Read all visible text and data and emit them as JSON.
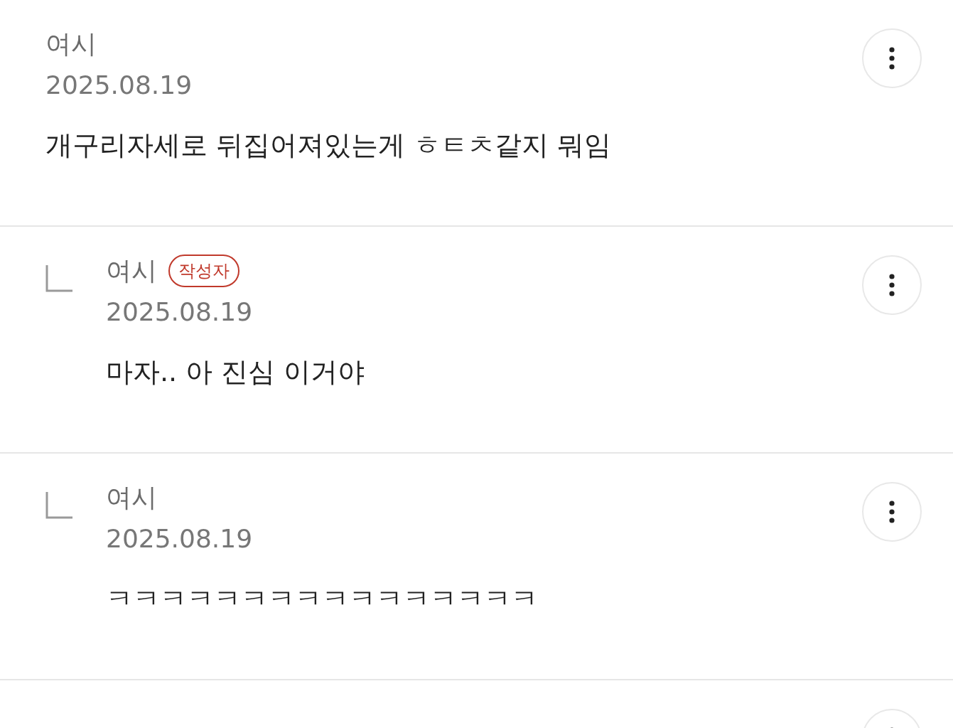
{
  "comments": [
    {
      "kind": "comment",
      "author": "여시",
      "date": "2025.08.19",
      "text": "개구리자세로 뒤집어져있는게 ㅎㅌㅊ같지 뭐임"
    },
    {
      "kind": "reply",
      "author": "여시",
      "writer_badge": "작성자",
      "date": "2025.08.19",
      "text": "마자.. 아 진심 이거야"
    },
    {
      "kind": "reply",
      "author": "여시",
      "date": "2025.08.19",
      "text": "ㅋㅋㅋㅋㅋㅋㅋㅋㅋㅋㅋㅋㅋㅋㅋㅋ"
    },
    {
      "kind": "comment"
    }
  ]
}
